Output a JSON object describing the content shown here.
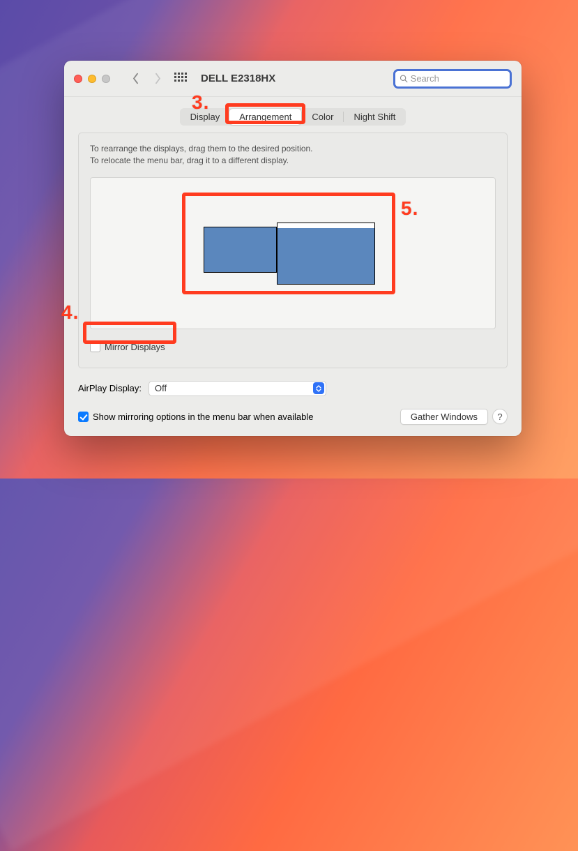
{
  "window": {
    "title": "DELL E2318HX",
    "search_placeholder": "Search"
  },
  "tabs": {
    "display": "Display",
    "arrangement": "Arrangement",
    "color": "Color",
    "night_shift": "Night Shift",
    "selected": "arrangement"
  },
  "instructions": {
    "line1": "To rearrange the displays, drag them to the desired position.",
    "line2": "To relocate the menu bar, drag it to a different display."
  },
  "mirror": {
    "label": "Mirror Displays",
    "checked": false
  },
  "airplay": {
    "label": "AirPlay Display:",
    "value": "Off"
  },
  "show_mirroring": {
    "label": "Show mirroring options in the menu bar when available",
    "checked": true
  },
  "buttons": {
    "gather": "Gather Windows",
    "help": "?"
  },
  "annotations": {
    "n3": "3.",
    "n4": "4.",
    "n5": "5."
  }
}
